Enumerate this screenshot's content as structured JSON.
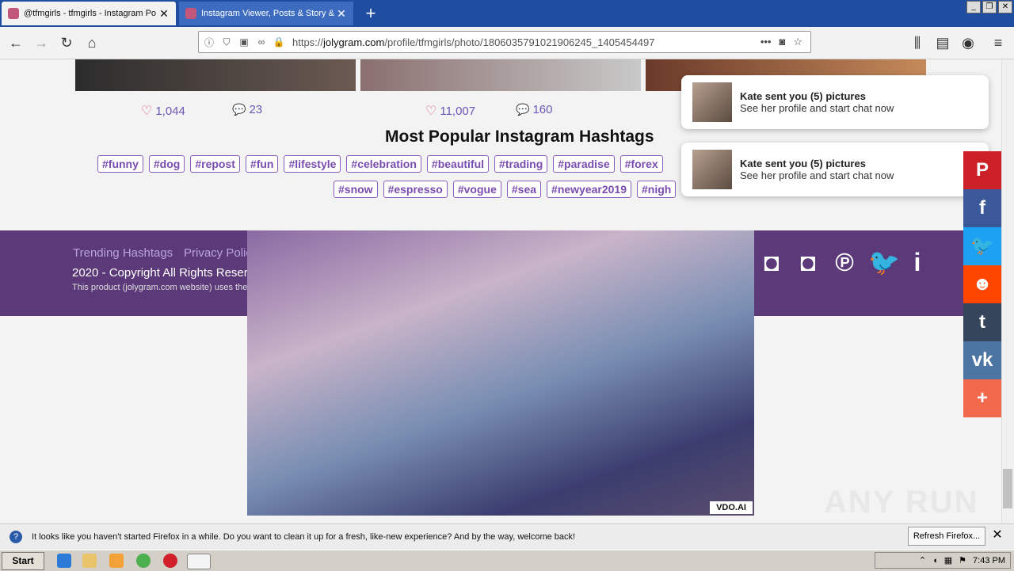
{
  "browser": {
    "tabs": [
      {
        "title": "@tfmgirls - tfmgirls - Instagram Po"
      },
      {
        "title": "Instagram Viewer, Posts & Story &"
      }
    ],
    "url_prefix": "https://",
    "url_domain": "jolygram.com",
    "url_path": "/profile/tfmgirls/photo/1806035791021906245_1405454497"
  },
  "posts": [
    {
      "likes": "1,044",
      "comments": "23"
    },
    {
      "likes": "11,007",
      "comments": "160"
    }
  ],
  "hashtags": {
    "title": "Most Popular Instagram Hashtags",
    "row1": [
      "#funny",
      "#dog",
      "#repost",
      "#fun",
      "#lifestyle",
      "#celebration",
      "#beautiful",
      "#trading",
      "#paradise",
      "#forex"
    ],
    "row2": [
      "#snow",
      "#espresso",
      "#vogue",
      "#sea",
      "#newyear2019",
      "#nigh"
    ]
  },
  "footer": {
    "links": [
      "Trending Hashtags",
      "Privacy Polic"
    ],
    "copyright": "2020 - Copyright All Rights Reserv",
    "product_note": "This product (jolygram.com website) uses the"
  },
  "ad": {
    "label": "VDO.AI"
  },
  "notifications": [
    {
      "title": "Kate sent you (5) pictures",
      "text": "See her profile and start chat now"
    },
    {
      "title": "Kate sent you (5) pictures",
      "text": "See her profile and start chat now"
    }
  ],
  "share_colors": {
    "pinterest": "#cb2027",
    "facebook": "#3b5998",
    "twitter": "#1da1f2",
    "reddit": "#ff4500",
    "tumblr": "#35465c",
    "vk": "#4c75a3",
    "more": "#f26a4b"
  },
  "watermark": "ANY RUN",
  "firefox_bar": {
    "message": "It looks like you haven't started Firefox in a while. Do you want to clean it up for a fresh, like-new experience? And by the way, welcome back!",
    "button": "Refresh Firefox..."
  },
  "taskbar": {
    "start": "Start",
    "clock": "7:43 PM"
  }
}
